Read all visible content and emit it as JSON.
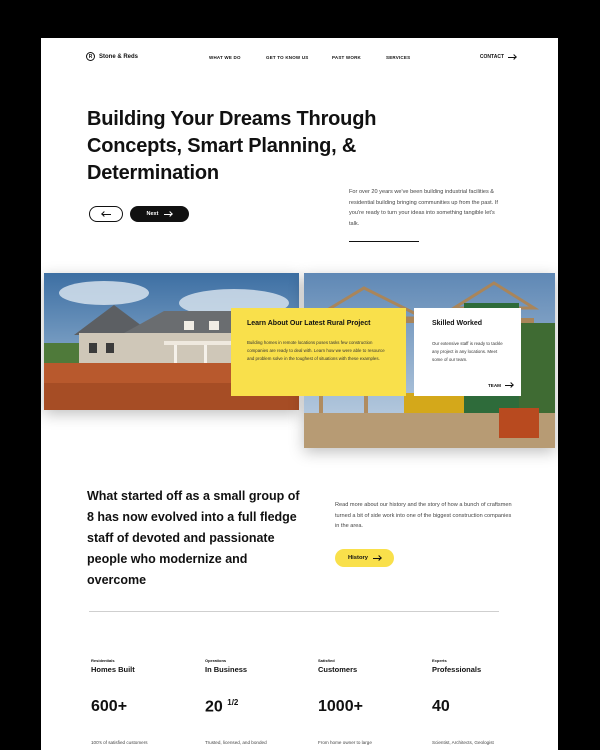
{
  "nav": {
    "brand": "Stone & Reds",
    "brand_mark": "R",
    "links": [
      "WHAT WE DO",
      "GET TO KNOW US",
      "PAST WORK",
      "SERVICES"
    ],
    "contact": "CONTACT"
  },
  "hero": {
    "title": "Building Your Dreams Through Concepts, Smart Planning, & Determination",
    "next_label": "Next",
    "description": "For over 20 years we've been building industrial facilities & residential building bringing communities up from the past. If you're ready to turn your ideas into something tangible let's talk."
  },
  "cards": {
    "project": {
      "title": "Learn About Our Latest Rural Project",
      "text": "Building homes in remote locations poses tasks few construction companies are ready to deal with. Learn how we were able to resource and problem solve in the toughest of situations with these examples."
    },
    "team": {
      "title": "Skilled Worked",
      "text": "Our extensive staff is ready to tackle any project in any locations. Meet some of our team.",
      "link": "TEAM"
    }
  },
  "about": {
    "title": "What started off as a small group of 8 has now evolved into a full fledge staff of devoted and passionate people who modernize and overcome",
    "description": "Read more about our history and the story of how a bunch of craftsmen turned a bit of side work into one of the biggest construction companies in the area.",
    "history_label": "History"
  },
  "stats": [
    {
      "caption": "Residentials",
      "label": "Homes Built",
      "value": "600+",
      "footer": "100's of satisfied customers"
    },
    {
      "caption": "Operations",
      "label": "In Business",
      "value": "20",
      "value_fraction": "1/2",
      "footer": "Trusted, licensed, and bonded"
    },
    {
      "caption": "Satisfied",
      "label": "Customers",
      "value": "1000+",
      "footer": "From home owner to large"
    },
    {
      "caption": "Experts",
      "label": "Professionals",
      "value": "40",
      "footer": "Scientist, Architects, Geologist"
    }
  ],
  "colors": {
    "accent": "#f9e04b",
    "text": "#111111",
    "background": "#ffffff",
    "frame": "#000000"
  }
}
